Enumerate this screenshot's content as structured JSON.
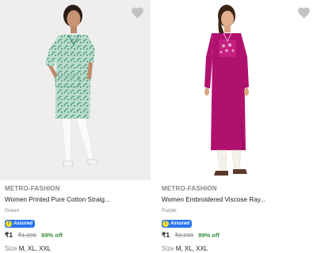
{
  "products": [
    {
      "brand": "METRO-FASHION",
      "title": "Women Printed Pure Cotton Straig...",
      "color": "Green",
      "assured_label": "Assured",
      "price": "₹1",
      "mrp": "₹1,399",
      "discount": "99% off",
      "size_label": "Size",
      "sizes": "M, XL, XXL",
      "wishlist_icon": "heart-icon",
      "image_colors": {
        "background": "#eeeeee",
        "garment": "#b9dcc9",
        "pattern": "#4c9a86"
      }
    },
    {
      "brand": "METRO-FASHION",
      "title": "Women Embroidered Viscose Ray...",
      "color": "Purple",
      "assured_label": "Assured",
      "price": "₹1",
      "mrp": "₹2,299",
      "discount": "99% off",
      "size_label": "Size",
      "sizes": "M, XL, XXL",
      "wishlist_icon": "heart-icon",
      "image_colors": {
        "background": "#ffffff",
        "garment": "#b0106e",
        "embroidery": "#e7a9c8"
      }
    }
  ],
  "colors": {
    "assured_badge": "#2874f0",
    "discount": "#388e3c",
    "muted_text": "#878787"
  }
}
